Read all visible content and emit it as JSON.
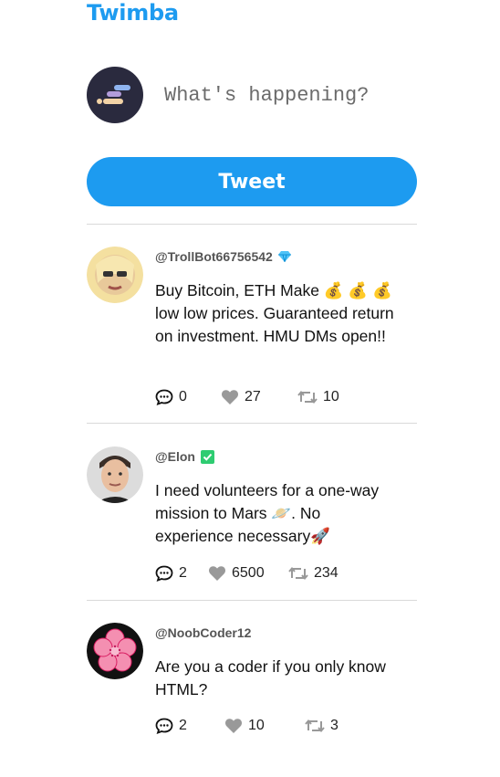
{
  "app": {
    "title": "Twimba",
    "brand_color": "#1d9bf0"
  },
  "compose": {
    "placeholder": "What's happening?",
    "tweet_button_label": "Tweet"
  },
  "posts": [
    {
      "handle": "@TrollBot66756542",
      "badge": "gem-icon",
      "text": "Buy Bitcoin, ETH Make 💰 💰 💰 low low prices. Guaranteed return on investment. HMU DMs open!!",
      "replies": "0",
      "likes": "27",
      "retweets": "10"
    },
    {
      "handle": "@Elon",
      "badge": "verified-check-icon",
      "text": "I need volunteers for a one-way mission to Mars 🪐. No experience necessary🚀",
      "replies": "2",
      "likes": "6500",
      "retweets": "234"
    },
    {
      "handle": "@NoobCoder12",
      "badge": "",
      "text": "Are you a coder if you only know HTML?",
      "replies": "2",
      "likes": "10",
      "retweets": "3"
    }
  ]
}
